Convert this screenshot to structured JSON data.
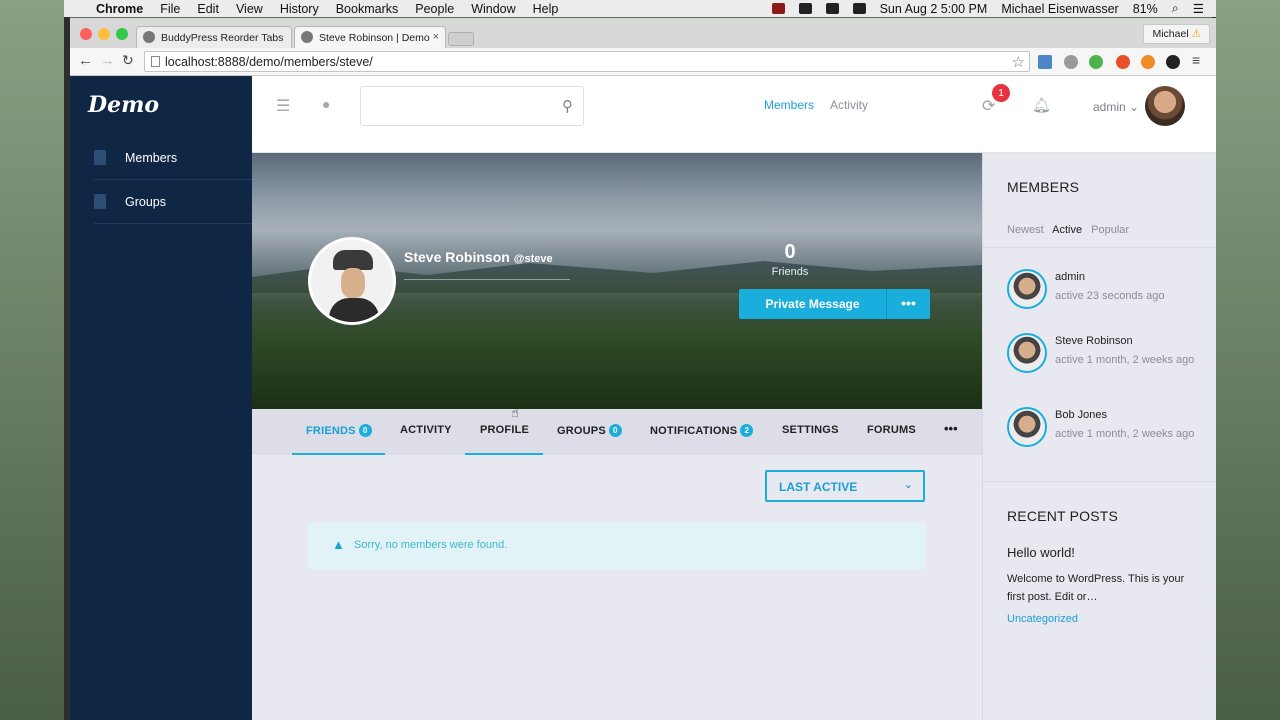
{
  "menubar": {
    "apple": "",
    "app": "Chrome",
    "items": [
      "File",
      "Edit",
      "View",
      "History",
      "Bookmarks",
      "People",
      "Window",
      "Help"
    ],
    "clock": "Sun Aug 2  5:00 PM",
    "user": "Michael Eisenwasser",
    "battery": "81%"
  },
  "browser": {
    "tabs": [
      {
        "title": "BuddyPress Reorder Tabs",
        "close": "×"
      },
      {
        "title": "Steve Robinson | Demo",
        "close": "×"
      }
    ],
    "profile_name": "Michael",
    "profile_warning": "⚠",
    "url": "localhost:8888/demo/members/steve/",
    "star": "☆"
  },
  "site": {
    "logo": "Demo",
    "sidebar": [
      {
        "label": "Members"
      },
      {
        "label": "Groups"
      }
    ],
    "topbar": {
      "nav": [
        "Members",
        "Activity"
      ],
      "notification_count": "1",
      "user_label": "admin ⌄"
    },
    "profile": {
      "name": "Steve Robinson",
      "handle": "@steve",
      "friends_count": "0",
      "friends_label": "Friends",
      "private_message": "Private Message",
      "more": "•••"
    },
    "subnav": [
      {
        "label": "FRIENDS",
        "badge": "0"
      },
      {
        "label": "ACTIVITY"
      },
      {
        "label": "PROFILE"
      },
      {
        "label": "GROUPS",
        "badge": "0"
      },
      {
        "label": "NOTIFICATIONS",
        "badge": "2"
      },
      {
        "label": "SETTINGS"
      },
      {
        "label": "FORUMS"
      }
    ],
    "subnav_more": "•••",
    "sort_select": "LAST ACTIVE",
    "empty_message": "Sorry, no members were found.",
    "widgets": {
      "members_title": "MEMBERS",
      "member_tabs": [
        "Newest",
        "Active",
        "Popular"
      ],
      "members": [
        {
          "name": "admin",
          "active": "active 23 seconds ago"
        },
        {
          "name": "Steve Robinson",
          "active": "active 1 month, 2 weeks ago"
        },
        {
          "name": "Bob Jones",
          "active": "active 1 month, 2 weeks ago"
        }
      ],
      "posts_title": "RECENT POSTS",
      "post": {
        "title": "Hello world!",
        "excerpt": "Welcome to WordPress. This is your first post. Edit or…",
        "category": "Uncategorized"
      }
    }
  },
  "colors": {
    "accent": "#1aaedc",
    "sidebar": "#0f2644",
    "badge_red": "#e8333f"
  }
}
